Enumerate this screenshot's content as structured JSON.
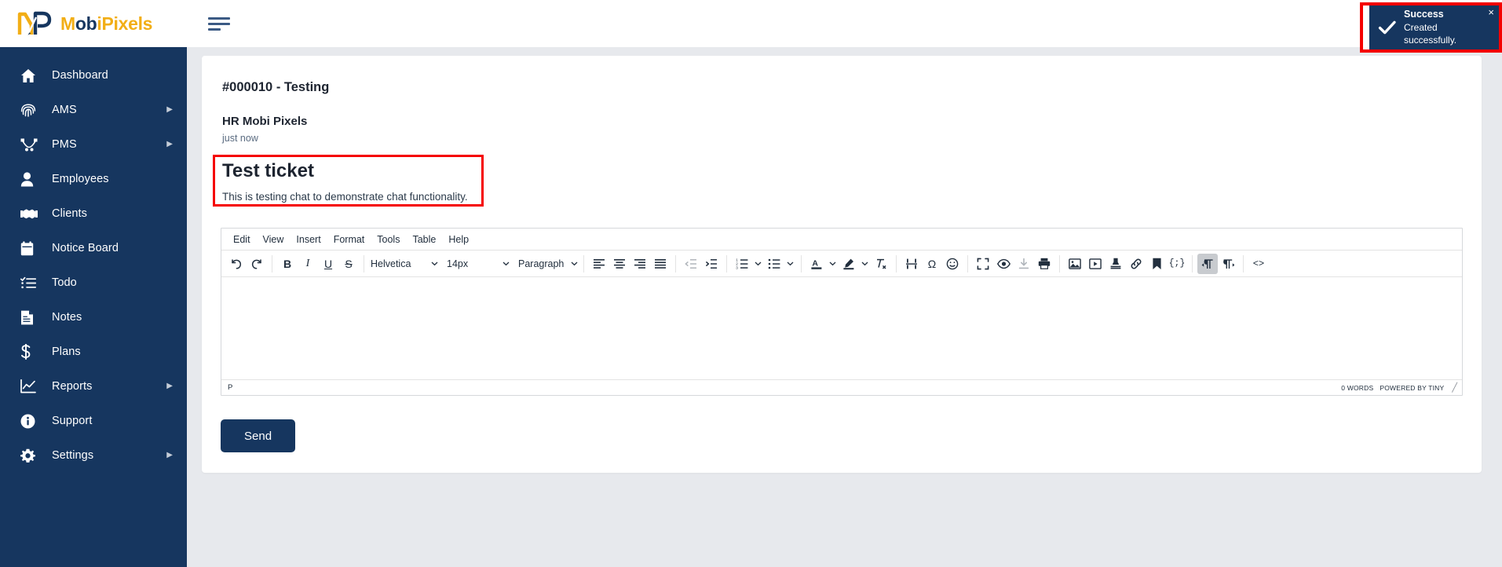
{
  "brand": {
    "name_part1": "M",
    "name_part2": "ob",
    "name_part3": "iPixels",
    "full": "MobiPixels"
  },
  "topbar": {
    "menu_toggle": "menu-toggle"
  },
  "sidebar": {
    "items": [
      {
        "label": "Dashboard",
        "icon": "home-icon",
        "has_submenu": false
      },
      {
        "label": "AMS",
        "icon": "fingerprint-icon",
        "has_submenu": true,
        "arrow": "▶"
      },
      {
        "label": "PMS",
        "icon": "project-nodes-icon",
        "has_submenu": true,
        "arrow": "▶"
      },
      {
        "label": "Employees",
        "icon": "person-icon",
        "has_submenu": false
      },
      {
        "label": "Clients",
        "icon": "handshake-icon",
        "has_submenu": false
      },
      {
        "label": "Notice Board",
        "icon": "clipboard-icon",
        "has_submenu": false
      },
      {
        "label": "Todo",
        "icon": "checklist-icon",
        "has_submenu": false
      },
      {
        "label": "Notes",
        "icon": "note-document-icon",
        "has_submenu": false
      },
      {
        "label": "Plans",
        "icon": "dollar-icon",
        "has_submenu": false
      },
      {
        "label": "Reports",
        "icon": "chart-line-icon",
        "has_submenu": true,
        "arrow": "▶"
      },
      {
        "label": "Support",
        "icon": "info-circle-icon",
        "has_submenu": false
      },
      {
        "label": "Settings",
        "icon": "gear-icon",
        "has_submenu": true,
        "arrow": "▶"
      }
    ]
  },
  "ticket": {
    "header": "#000010 - Testing",
    "author": "HR Mobi Pixels",
    "timestamp": "just now",
    "message_title": "Test ticket",
    "message_body": "This is testing chat to demonstrate chat functionality."
  },
  "editor": {
    "menubar": [
      "Edit",
      "View",
      "Insert",
      "Format",
      "Tools",
      "Table",
      "Help"
    ],
    "font_family": "Helvetica",
    "font_size": "14px",
    "block_format": "Paragraph",
    "content": "",
    "status_path": "P",
    "word_count": "0 WORDS",
    "powered_by": "POWERED BY TINY",
    "toolbar": [
      {
        "name": "undo-icon",
        "title": "Undo"
      },
      {
        "name": "redo-icon",
        "title": "Redo"
      },
      {
        "name": "bold-icon",
        "title": "Bold",
        "glyph": "B"
      },
      {
        "name": "italic-icon",
        "title": "Italic",
        "glyph": "I"
      },
      {
        "name": "underline-icon",
        "title": "Underline",
        "glyph": "U"
      },
      {
        "name": "strikethrough-icon",
        "title": "Strikethrough",
        "glyph": "S"
      },
      {
        "name": "align-left-icon",
        "title": "Align left"
      },
      {
        "name": "align-center-icon",
        "title": "Align center"
      },
      {
        "name": "align-right-icon",
        "title": "Align right"
      },
      {
        "name": "align-justify-icon",
        "title": "Justify"
      },
      {
        "name": "outdent-icon",
        "title": "Decrease indent"
      },
      {
        "name": "indent-icon",
        "title": "Increase indent"
      },
      {
        "name": "numbered-list-icon",
        "title": "Numbered list"
      },
      {
        "name": "bullet-list-icon",
        "title": "Bullet list"
      },
      {
        "name": "text-color-icon",
        "title": "Text color"
      },
      {
        "name": "highlight-color-icon",
        "title": "Background color"
      },
      {
        "name": "clear-formatting-icon",
        "title": "Clear formatting"
      },
      {
        "name": "page-break-icon",
        "title": "Page break"
      },
      {
        "name": "special-character-icon",
        "title": "Special character",
        "glyph": "Ω"
      },
      {
        "name": "emoticon-icon",
        "title": "Emoticons"
      },
      {
        "name": "fullscreen-icon",
        "title": "Fullscreen"
      },
      {
        "name": "preview-icon",
        "title": "Preview"
      },
      {
        "name": "export-icon",
        "title": "Export"
      },
      {
        "name": "print-icon",
        "title": "Print"
      },
      {
        "name": "insert-image-icon",
        "title": "Insert image"
      },
      {
        "name": "insert-media-icon",
        "title": "Insert media"
      },
      {
        "name": "insert-template-icon",
        "title": "Insert template"
      },
      {
        "name": "insert-link-icon",
        "title": "Insert link"
      },
      {
        "name": "anchor-icon",
        "title": "Anchor"
      },
      {
        "name": "code-sample-icon",
        "title": "Code sample",
        "glyph": "{;}"
      },
      {
        "name": "ltr-icon",
        "title": "Left to right",
        "active": true
      },
      {
        "name": "rtl-icon",
        "title": "Right to left"
      },
      {
        "name": "source-code-icon",
        "title": "Source code",
        "glyph": "<>"
      }
    ]
  },
  "actions": {
    "send_label": "Send"
  },
  "toast": {
    "title": "Success",
    "message": "Created successfully.",
    "close_label": "×",
    "icon": "check-icon",
    "bg_color": "#16365f",
    "annotation_color": "#f50000"
  }
}
